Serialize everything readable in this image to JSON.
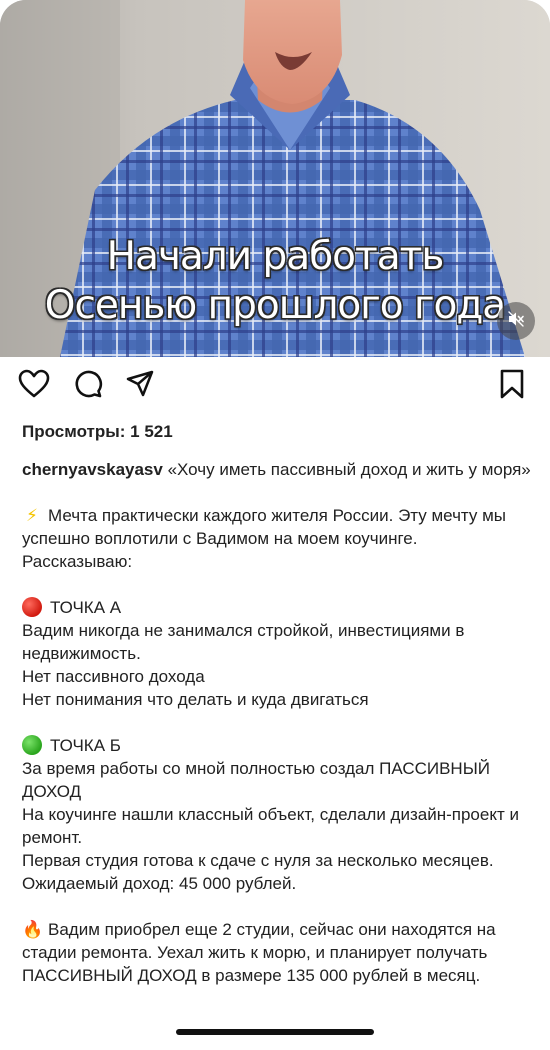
{
  "video": {
    "caption_line1": "Начали работать",
    "caption_line2": "Осенью прошлого года",
    "mute_icon": "speaker-muted-icon"
  },
  "actions": {
    "like_icon": "heart-icon",
    "comment_icon": "comment-bubble-icon",
    "share_icon": "paper-plane-icon",
    "save_icon": "bookmark-icon"
  },
  "post": {
    "views": "Просмотры: 1 521",
    "username": "chernyavskayasv",
    "title": "«Хочу иметь пассивный доход и жить у моря»",
    "intro_emoji": "⚡",
    "intro": "Мечта практически каждого жителя России. Эту мечту мы успешно воплотили с Вадимом на моем коучинге. Рассказываю:",
    "point_a": {
      "heading": "ТОЧКА А",
      "lines": [
        "Вадим никогда не занимался стройкой, инвестициями в недвижимость.",
        "Нет пассивного дохода",
        "Нет понимания что делать и куда двигаться"
      ]
    },
    "point_b": {
      "heading": "ТОЧКА Б",
      "lines": [
        "За время работы со мной полностью создал ПАССИВНЫЙ ДОХОД",
        "На коучинге нашли классный объект, сделали дизайн-проект и ремонт.",
        "Первая студия готова к сдаче с нуля за несколько месяцев. Ожидаемый доход: 45 000 рублей."
      ]
    },
    "outro_emoji": "🔥",
    "outro": "Вадим приобрел еще 2 студии, сейчас они находятся на стадии ремонта. Уехал жить к морю, и планирует получать ПАССИВНЫЙ ДОХОД в размере 135 000 рублей в месяц."
  },
  "colors": {
    "shirt_blue": "#5a7cc8",
    "text": "#222222",
    "point_a_dot": "#e0231a",
    "point_b_dot": "#35b027"
  }
}
